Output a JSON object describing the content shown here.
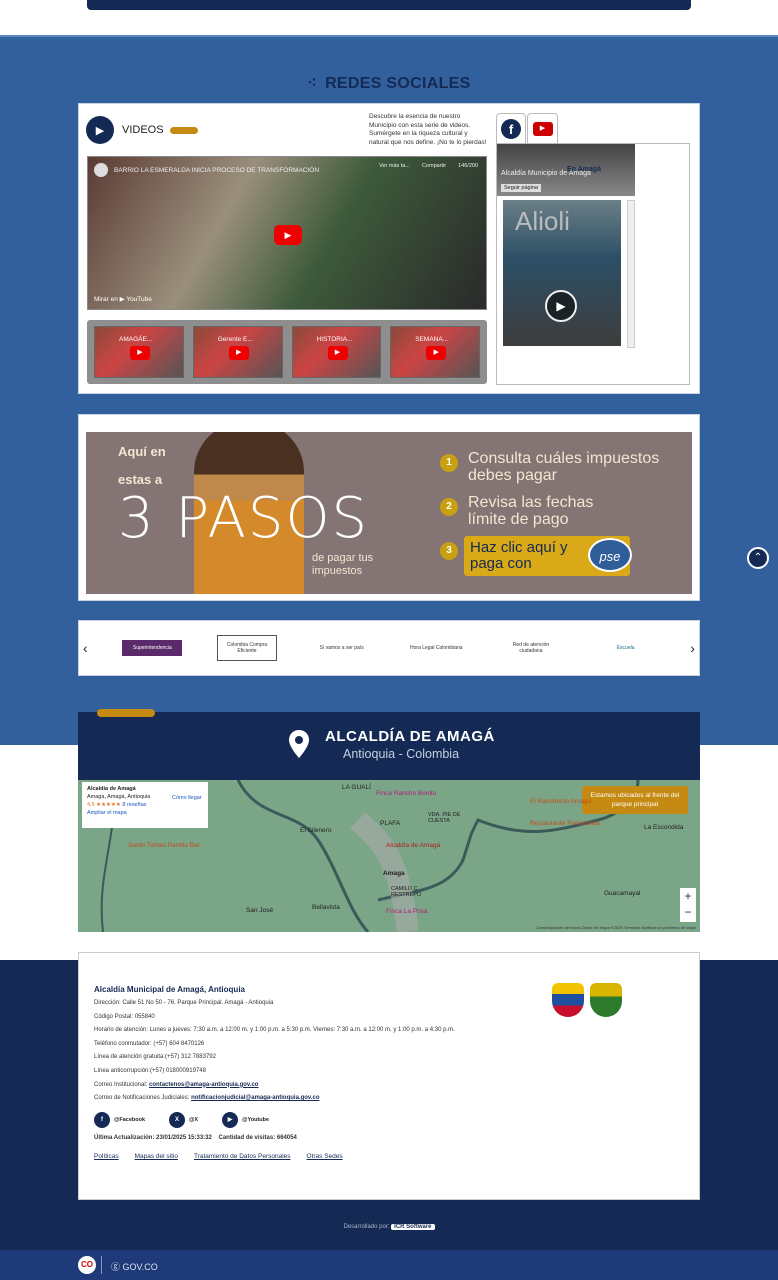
{
  "colors": {
    "navy": "#142a55",
    "blue": "#32609d",
    "gold": "#c48a12"
  },
  "redes": {
    "title": "REDES SOCIALES",
    "videos_label": "VIDEOS",
    "videos_description": "Descubre la esencia de nuestro Municipio con esta serie de videos. Sumérgete en la riqueza cultural y natural que nos define. ¡No te lo pierdas!",
    "player": {
      "title": "BARRIO LA ESMERALDA INICIA PROCESO DE TRANSFORMACIÓN",
      "watch_later": "Ver más ta...",
      "share": "Compartir",
      "counter": "146/200",
      "watch_on": "Mirar en ▶ YouTube"
    },
    "thumbs": [
      {
        "title": "AMAGÁE..."
      },
      {
        "title": "Gerente E..."
      },
      {
        "title": "HISTORIA..."
      },
      {
        "title": "SEMANA..."
      }
    ],
    "facebook": {
      "page_name": "Alcaldía Municipio de Amagá",
      "follow": "Seguir página",
      "promo": "En Amagá",
      "post_text": "Alioli"
    }
  },
  "banner": {
    "line1": "Aquí en",
    "line2": "estas a",
    "big": "3 PASOS",
    "sub": "de pagar tus impuestos",
    "steps": [
      {
        "n": "1",
        "text": "Consulta cuáles impuestos debes pagar"
      },
      {
        "n": "2",
        "text": "Revisa las fechas límite de pago"
      },
      {
        "n": "3",
        "text": "Haz clic aquí y paga con"
      }
    ],
    "pse": "pse"
  },
  "logos": [
    "Superintendencia",
    "Colombia Compra Eficiente",
    "Sí vamos a ser país",
    "Hora Legal Colombiana",
    "Red de atención ciudadana",
    "Escuela"
  ],
  "map": {
    "title": "ALCALDÍA DE AMAGÁ",
    "subtitle": "Antioquia - Colombia",
    "info": {
      "name": "Alcaldía de Amagá",
      "address": "Amaga, Amagá, Antioquia",
      "rating": "4,5 ★★★★★",
      "reviews": "8 reseñas",
      "enlarge": "Ampliar el mapa",
      "directions": "Cómo llegar"
    },
    "badge": "Estamos ubicados al frente del parque principal",
    "places": [
      "LA GUALÍ",
      "Finca Rancho Bonito",
      "El Silenero",
      "PLAFA",
      "VDA. PIE DE CUESTA",
      "Alcaldía de Amagá",
      "Amaga",
      "CAMILO C. RESTREPO",
      "Santo Tomas Parrilla Bar",
      "El Ranchento Amagá",
      "Restaurante Pamplonita",
      "La Escondida",
      "Guacamayal",
      "San José",
      "Bellavista",
      "Finca La Posa"
    ],
    "attribution": "Combinaciones de teclas   Datos del mapa ©2025   Términos   Notificar un problema de Maps"
  },
  "footer": {
    "title": "Alcaldía Municipal de Amagá, Antioquia",
    "lines": [
      "Dirección: Calle 51 No 50 - 76. Parque Principal. Amagá - Antioquia",
      "Código Postal: 055840",
      "Horario de atención: Lunes a jueves: 7:30 a.m. a 12:00 m. y 1:00 p.m. a 5:30 p.m. Viernes: 7:30 a.m. a 12:00 m. y 1:00 p.m. a 4:30 p.m.",
      "Teléfono conmutador: (+57) 604 8470126",
      "Línea de atención gratuita:(+57) 312 7883792",
      "Línea anticorrupción:(+57) 018000919748"
    ],
    "email_label": "Correo Institucional:",
    "email": "contactenos@amaga-antioquia.gov.co",
    "judicial_label": "Correo de Notificaciones Judiciales:",
    "judicial_email": "notificacionjudicial@amaga-antioquia.gov.co",
    "socials": [
      "@Facebook",
      "@X",
      "@Youtube"
    ],
    "updated": "Última Actualización: 23/01/2025 15:33:32",
    "visits": "Cantidad de visitas: 664054",
    "links": [
      "Políticas",
      "Mapas del sitio",
      "Tratamiento de Datos Personales",
      "Otras Sedes"
    ],
    "developed_by": "Desarrollado por:",
    "developer": "ICR Software"
  },
  "govbar": {
    "label": "GOV.CO",
    "logo": "CO"
  }
}
